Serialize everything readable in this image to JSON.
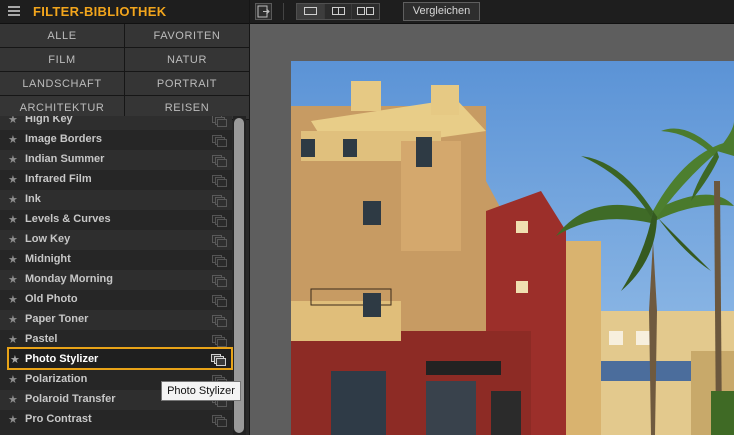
{
  "panel": {
    "title": "FILTER-BIBLIOTHEK",
    "categories": [
      [
        "ALLE",
        "FAVORITEN"
      ],
      [
        "FILM",
        "NATUR"
      ],
      [
        "LANDSCHAFT",
        "PORTRAIT"
      ],
      [
        "ARCHITEKTUR",
        "REISEN"
      ]
    ],
    "filters": [
      "High Key",
      "Image Borders",
      "Indian Summer",
      "Infrared Film",
      "Ink",
      "Levels & Curves",
      "Low Key",
      "Midnight",
      "Monday Morning",
      "Old Photo",
      "Paper Toner",
      "Pastel",
      "Photo Stylizer",
      "Polarization",
      "Polaroid Transfer",
      "Pro Contrast"
    ],
    "selected_index": 12,
    "tooltip": "Photo Stylizer"
  },
  "toolbar": {
    "compare_label": "Vergleichen"
  },
  "colors": {
    "accent": "#f2a51c",
    "selection_border": "#e8a318",
    "canvas": "#5e5e5e"
  }
}
